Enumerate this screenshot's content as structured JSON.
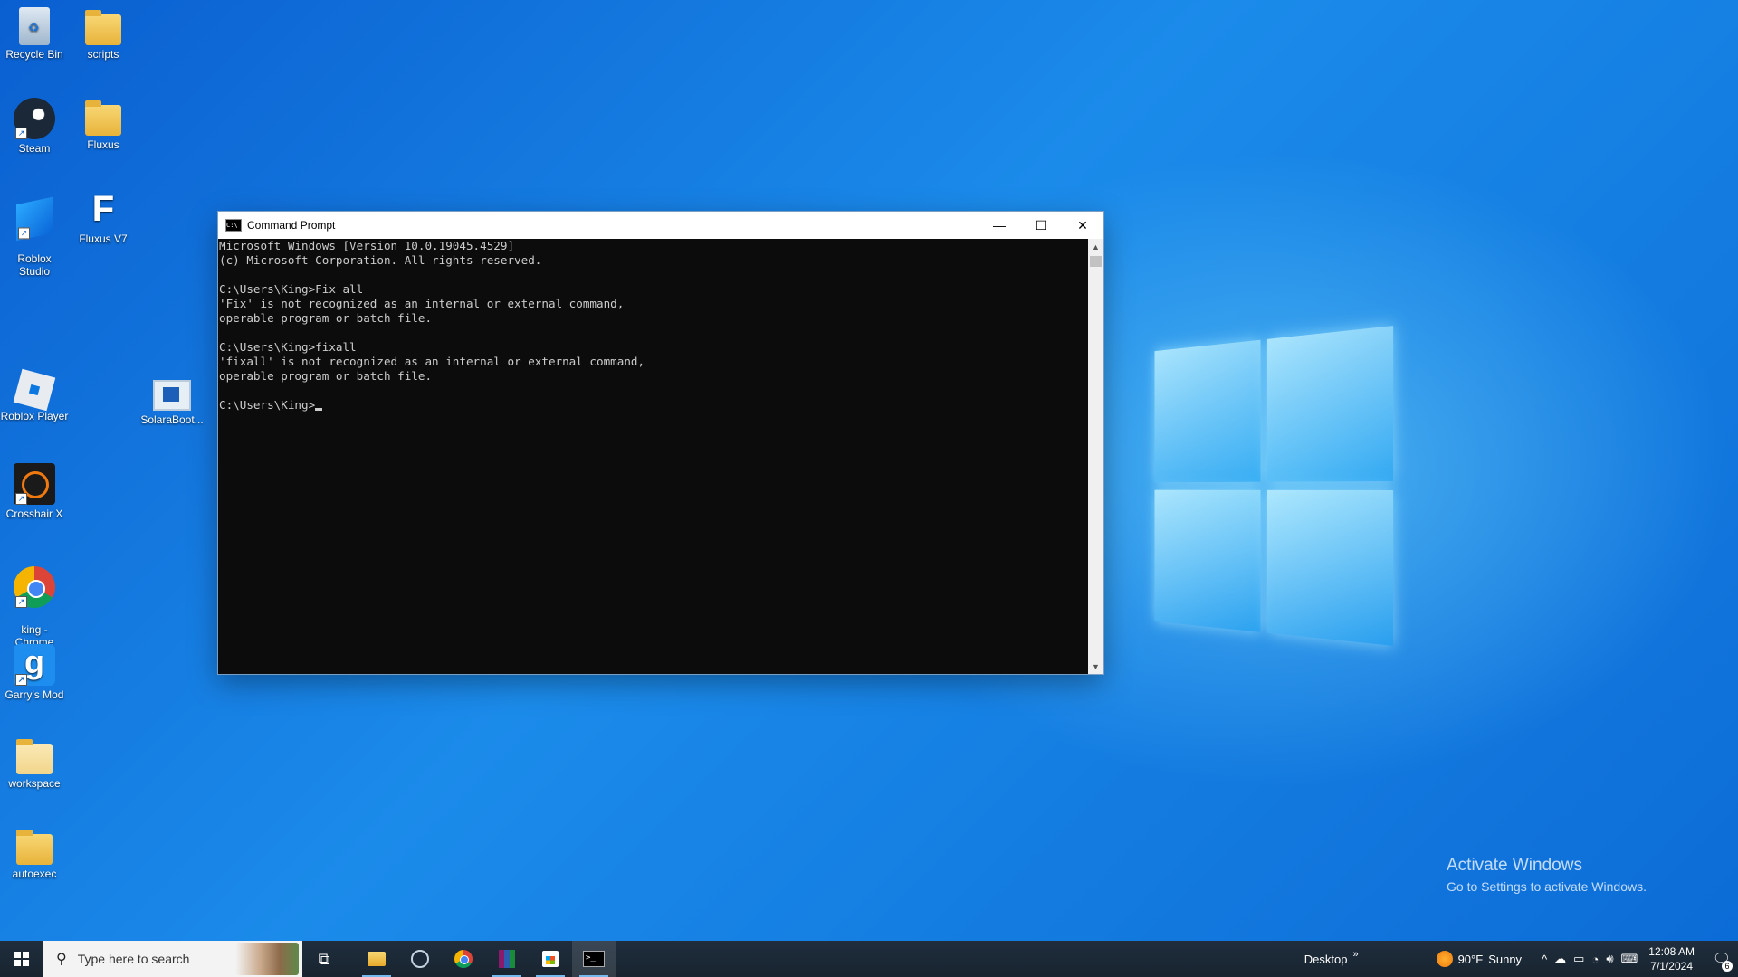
{
  "desktop": {
    "icons": [
      {
        "label": "Recycle Bin"
      },
      {
        "label": "scripts"
      },
      {
        "label": "Steam"
      },
      {
        "label": "Fluxus"
      },
      {
        "label": "Roblox\nStudio"
      },
      {
        "label": "Fluxus V7"
      },
      {
        "label": "Roblox Player"
      },
      {
        "label": "SolaraBoot..."
      },
      {
        "label": "Crosshair X"
      },
      {
        "label": "king -\nChrome"
      },
      {
        "label": "Garry's Mod"
      },
      {
        "label": "workspace"
      },
      {
        "label": "autoexec"
      }
    ]
  },
  "cmd": {
    "title": "Command Prompt",
    "icon": "cmd-icon",
    "lines": [
      "Microsoft Windows [Version 10.0.19045.4529]",
      "(c) Microsoft Corporation. All rights reserved.",
      "",
      "C:\\Users\\King>Fix all",
      "'Fix' is not recognized as an internal or external command,",
      "operable program or batch file.",
      "",
      "C:\\Users\\King>fixall",
      "'fixall' is not recognized as an internal or external command,",
      "operable program or batch file.",
      "",
      "C:\\Users\\King>"
    ],
    "minimize": "—",
    "maximize": "☐",
    "close": "✕"
  },
  "watermark": {
    "line1": "Activate Windows",
    "line2": "Go to Settings to activate Windows."
  },
  "taskbar": {
    "search_placeholder": "Type here to search",
    "desktop_label": "Desktop",
    "desktop_chevron": "»",
    "weather_temp": "90°F",
    "weather_cond": "Sunny",
    "time": "12:08 AM",
    "date": "7/1/2024",
    "notifications": "6"
  },
  "colors": {
    "desktop_blue": "#0a78e0",
    "console_bg": "#0c0c0c",
    "console_fg": "#cccccc",
    "taskbar_bg": "#1c2a3a",
    "active_indicator": "#76b9ed"
  }
}
